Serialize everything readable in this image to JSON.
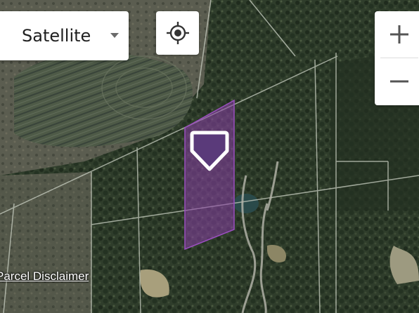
{
  "map": {
    "layer_select": {
      "selected": "Satellite",
      "icon": "chevron-down-icon"
    },
    "locate_button": {
      "icon": "crosshair-icon"
    },
    "zoom": {
      "in_icon": "plus-icon",
      "out_icon": "minus-icon"
    },
    "parcel": {
      "marker_icon": "pentagon-pin-icon",
      "highlight_color": "#8a3fa8"
    },
    "disclaimer_link": "Parcel Disclaimer"
  }
}
